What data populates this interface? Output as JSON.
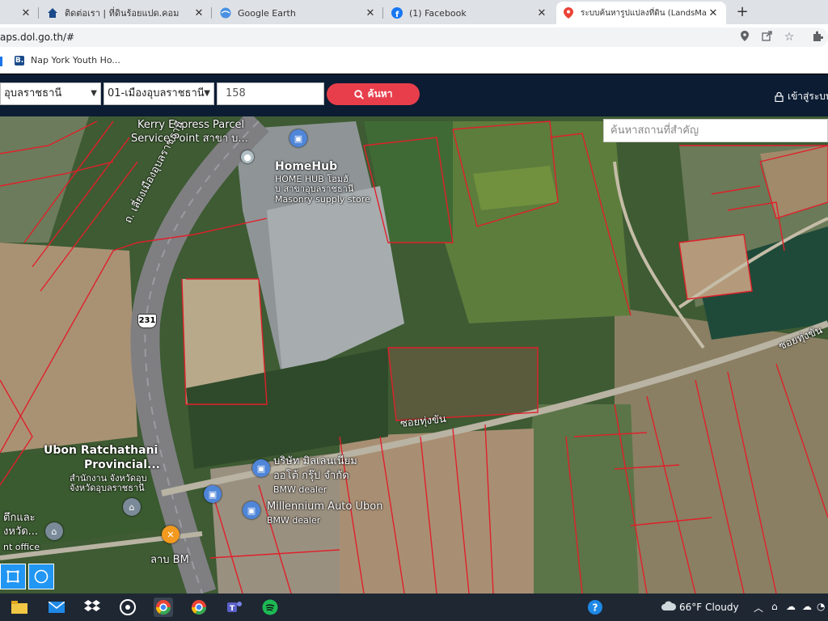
{
  "browser": {
    "tabs": [
      {
        "title": "ติดต่อเรา | ที่ดินร้อยแปด.คอม",
        "icon": "home-icon"
      },
      {
        "title": "Google Earth",
        "icon": "earth-icon"
      },
      {
        "title": "(1) Facebook",
        "icon": "facebook-icon"
      },
      {
        "title": "ระบบค้นหารูปแปลงที่ดิน (LandsMaps)",
        "icon": "map-pin-icon",
        "active": true
      }
    ],
    "url": "aps.dol.go.th/#",
    "bookmark": {
      "label": "Nap York Youth Ho...",
      "badge": "B."
    }
  },
  "toolbar": {
    "province": "อุบลราชธานี",
    "district": "01-เมืองอุบลราชธานี",
    "parcel_no": "158",
    "search_label": "ค้นหา",
    "login_label": "เข้าสู่ระบบ"
  },
  "map": {
    "place_search_placeholder": "ค้นหาสถานที่สำคัญ",
    "labels": {
      "kerry1": "Kerry Express Parcel",
      "kerry2": "Service Point สาขา บ...",
      "homehub": "HomeHub",
      "homehub_th1": "HOME HUB โฮมฮั",
      "homehub_th2": "บ สาขาอุบลราชธานี",
      "homehub_cat": "Masonry supply store",
      "road_vertical": "ถ. เลี่ยงเมืองอุบลราชธานี",
      "route_no": "231",
      "soi_thungsan": "ซอยทุ่งขัน",
      "soi_right": "ซอยทุ่งขัน",
      "ubon1": "Ubon Ratchathani",
      "ubon2": "Provincial...",
      "ubon_th1": "สำนักงาน จังหวัดอุบ",
      "ubon_th2": "จังหวัดอุบลราชธานี",
      "bmw_th1": "บริษัท มิลเลนเนียม",
      "bmw_th2": "ออโต้ กรุ๊ป จำกัด",
      "bmw_dealer1": "BMW dealer",
      "millennium": "Millennium Auto Ubon",
      "bmw_dealer2": "BMW dealer",
      "left_th1": "ตึกและ",
      "left_th2": "งหวัด...",
      "office": "nt office",
      "labbm": "ลาบ BM"
    }
  },
  "taskbar": {
    "weather_temp": "66°F",
    "weather_text": "Cloudy",
    "icons": [
      "file-explorer-icon",
      "mail-icon",
      "dropbox-icon",
      "obs-icon",
      "chrome-icon",
      "chrome-icon",
      "teams-icon",
      "spotify-icon"
    ]
  },
  "colors": {
    "accent": "#e83e4c",
    "site_header": "#0b1c33",
    "parcel_line": "#e0202a"
  }
}
